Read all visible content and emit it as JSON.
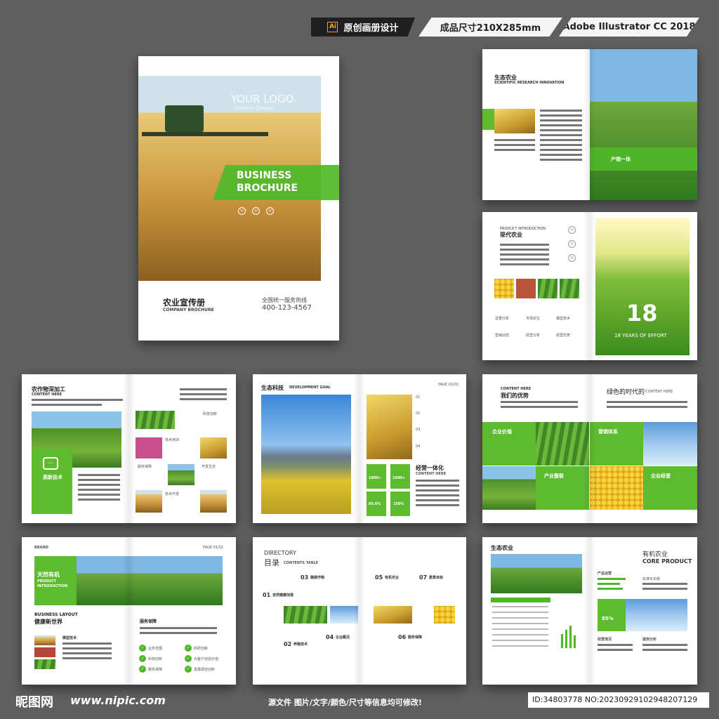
{
  "header": {
    "tag1": "原创画册设计",
    "tag2": "成品尺寸210X285mm",
    "tag3": "Adobe Illustrator CC 2018",
    "ai_icon": "Ai"
  },
  "cover": {
    "logo": "YOUR LOGO",
    "logo_sub": "Creative Design",
    "banner_line1": "BUSINESS",
    "banner_line2": "BROCHURE",
    "title": "农业宣传册",
    "subtitle": "COMPANY BROCHURE",
    "hotline_label": "全国统一服务热线",
    "hotline": "400-123-4567"
  },
  "p1": {
    "title": "生态农业",
    "subtitle": "SCIENTIFIC RESEARCH INNOVATION",
    "banner": "产销一体"
  },
  "p2": {
    "kicker": "PRODUCT INTRODUCTION",
    "title": "现代农业",
    "big_num": "18",
    "years": "18 YEARS OF EFFORT",
    "labels": [
      "显著分析",
      "市场定位",
      "模型技术",
      "营销动态",
      "经营分析",
      "经营优势"
    ]
  },
  "p3": {
    "title": "农作物深加工",
    "subtitle": "CONTENT HERE",
    "green_label": "高新技术",
    "labels": [
      "科技创新",
      "技术培训",
      "服务保障",
      "开发生态",
      "技术开发",
      "项目开发",
      "开发生态"
    ]
  },
  "p4": {
    "title": "生态科技",
    "title_en": "DEVELOPMENT GOAL",
    "page": "PAGE 01/02",
    "list": [
      "01",
      "02",
      "03",
      "04"
    ],
    "heading": "经营一体化",
    "heading_sub": "CONTENT HERE",
    "stats": [
      "1800+",
      "1600+",
      "85.6%",
      "150%"
    ]
  },
  "p5": {
    "kicker": "CONTENT HERE",
    "title": "我们的优势",
    "title_right": "绿色的时代的",
    "title_right_sub": "CONTENT HERE",
    "cells": [
      "企业价值",
      "营销体系",
      "产业整联",
      "企业经营"
    ]
  },
  "p6": {
    "brand": "BRAND",
    "page": "PAGE 01/02",
    "green_title": "天然有机",
    "green_sub1": "PRODUCT",
    "green_sub2": "INTRODUCTION",
    "layout_en": "BUSINESS LAYOUT",
    "layout_cn": "健康新世界",
    "service": "服务保障",
    "model": "模型技术",
    "bullets": [
      "业务范围",
      "科研创新",
      "科技创新",
      "为客户创造价值",
      "服务保障",
      "发展源自创新"
    ]
  },
  "p7": {
    "dir_en": "DIRECTORY",
    "dir_cn": "目录",
    "contents": "CONTENTS TABLE",
    "items": [
      {
        "n": "01",
        "t": "自然健康加值"
      },
      {
        "n": "02",
        "t": "养殖技术"
      },
      {
        "n": "03",
        "t": "蔬菜作物"
      },
      {
        "n": "04",
        "t": "企业概况"
      },
      {
        "n": "05",
        "t": "有机农业"
      },
      {
        "n": "06",
        "t": "服务保障"
      },
      {
        "n": "07",
        "t": "愿景目标"
      }
    ]
  },
  "p8": {
    "title": "生态农业",
    "right_cn": "有机农业",
    "right_en": "CORE PRODUCT",
    "label1": "产品运营",
    "label2": "标准化实施",
    "percent": "85%",
    "label3": "经营境况",
    "label4": "提供分析"
  },
  "footer": {
    "logo": "昵图网",
    "url": "www.nipic.com",
    "note": "源文件 图片/文字/颜色/尺寸等信息均可修改!",
    "id": "ID:34803778 NO:20230929102948207129"
  },
  "colors": {
    "accent": "#5dbb2e",
    "bg": "#5f5f5f"
  }
}
